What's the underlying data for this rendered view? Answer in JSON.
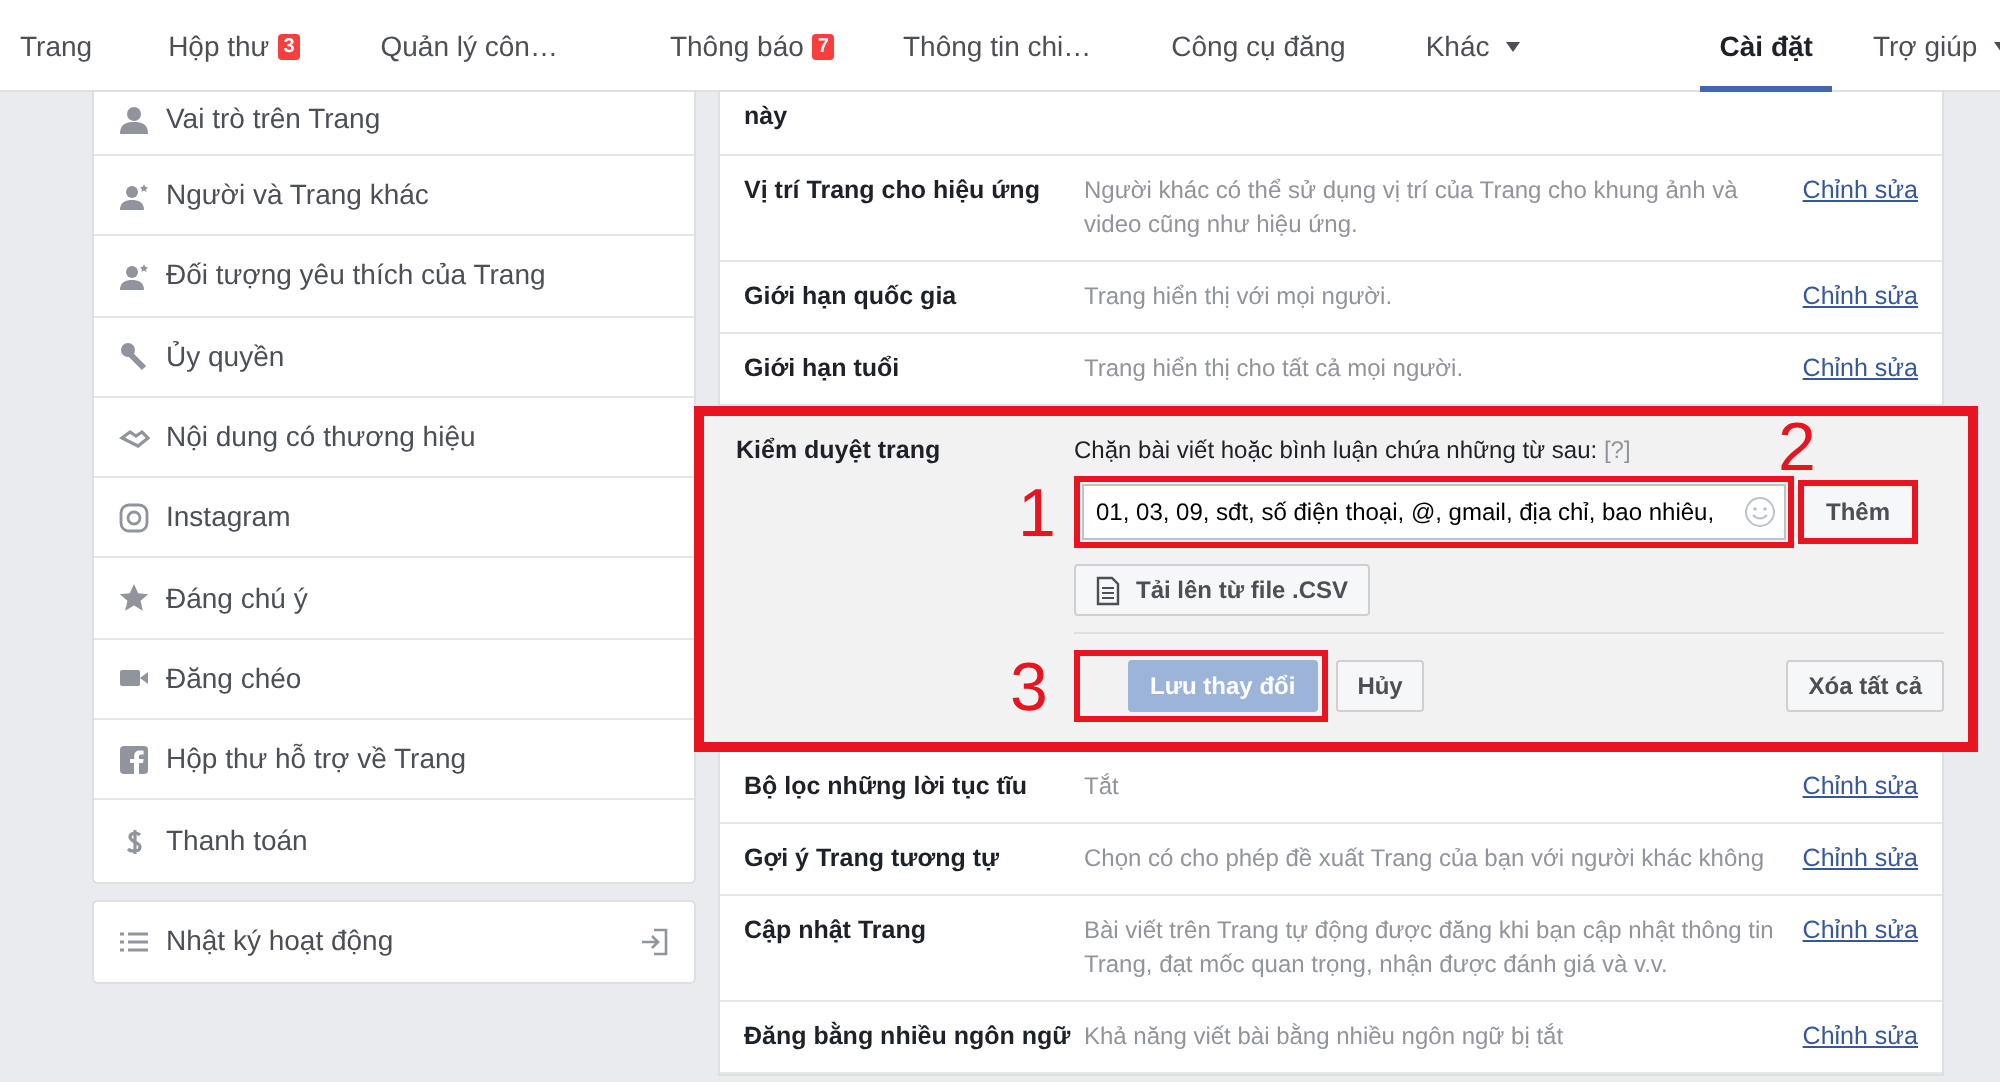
{
  "nav": [
    {
      "label": "Trang",
      "selected": false
    },
    {
      "label": "Hộp thư",
      "badge": "3",
      "selected": false
    },
    {
      "label": "Quản lý côn…",
      "selected": false
    },
    {
      "label": "Thông báo",
      "badge": "7",
      "selected": false
    },
    {
      "label": "Thông tin chi…",
      "selected": false
    },
    {
      "label": "Công cụ đăng",
      "selected": false
    },
    {
      "label": "Khác",
      "menu": true,
      "selected": false
    },
    {
      "label": "Cài đặt",
      "selected": true
    },
    {
      "label": "Trợ giúp",
      "menu": true,
      "selected": false
    }
  ],
  "sidebar": {
    "items": [
      {
        "label": "Vai trò trên Trang"
      },
      {
        "label": "Người và Trang khác"
      },
      {
        "label": "Đối tượng yêu thích của Trang"
      },
      {
        "label": "Ủy quyền"
      },
      {
        "label": "Nội dung có thương hiệu"
      },
      {
        "label": "Instagram"
      },
      {
        "label": "Đáng chú ý"
      },
      {
        "label": "Đăng chéo"
      },
      {
        "label": "Hộp thư hỗ trợ về Trang"
      },
      {
        "label": "Thanh toán"
      }
    ],
    "activity_log": {
      "label": "Nhật ký hoạt động"
    }
  },
  "settings": [
    {
      "kind": "row",
      "label": "này"
    },
    {
      "kind": "row",
      "label": "Vị trí Trang cho hiệu ứng",
      "value": "Người khác có thể sử dụng vị trí của Trang cho khung ảnh và video cũng như hiệu ứng.",
      "action": "Chỉnh sửa"
    },
    {
      "kind": "row",
      "label": "Giới hạn quốc gia",
      "value": "Trang hiển thị với mọi người.",
      "action": "Chỉnh sửa"
    },
    {
      "kind": "row",
      "label": "Giới hạn tuổi",
      "value": "Trang hiển thị cho tất cả mọi người.",
      "action": "Chỉnh sửa"
    },
    {
      "kind": "moderation",
      "label": "Kiểm duyệt trang",
      "prompt": "Chặn bài viết hoặc bình luận chứa những từ sau:",
      "help": "[?]",
      "keywords": "01, 03, 09, sđt, số điện thoại, @, gmail, địa chỉ, bao nhiêu,",
      "add": "Thêm",
      "upload": "Tải lên từ file .CSV",
      "save": {
        "label": "Lưu thay đổi",
        "disabled": true
      },
      "cancel": "Hủy",
      "clear": "Xóa tất cả"
    },
    {
      "kind": "row",
      "label": "Bộ lọc những lời tục tĩu",
      "value": "Tắt",
      "action": "Chỉnh sửa"
    },
    {
      "kind": "row",
      "label": "Gợi ý Trang tương tự",
      "value": "Chọn có cho phép đề xuất Trang của bạn với người khác không",
      "action": "Chỉnh sửa"
    },
    {
      "kind": "row",
      "label": "Cập nhật Trang",
      "value": "Bài viết trên Trang tự động được đăng khi bạn cập nhật thông tin Trang, đạt mốc quan trọng, nhận được đánh giá và v.v.",
      "action": "Chỉnh sửa"
    },
    {
      "kind": "row",
      "label": "Đăng bằng nhiều ngôn ngữ",
      "value": "Khả năng viết bài bằng nhiều ngôn ngữ bị tắt",
      "action": "Chỉnh sửa"
    }
  ],
  "annotations": [
    {
      "label": "1"
    },
    {
      "label": "2"
    },
    {
      "label": "3"
    }
  ]
}
